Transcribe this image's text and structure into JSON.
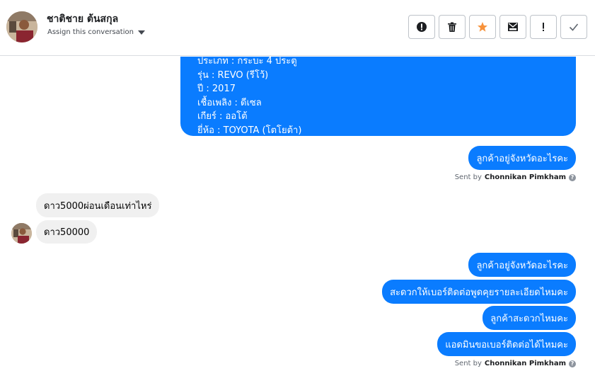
{
  "header": {
    "contact_name": "ชาติชาย ต้นสกุล",
    "assign_label": "Assign this conversation",
    "actions": [
      "spam-icon",
      "delete-icon",
      "star-icon",
      "mark-unread-icon",
      "important-icon",
      "done-icon"
    ]
  },
  "colors": {
    "accent": "#0a7cff",
    "star": "#f7923b",
    "incoming_bg": "#f0f0f0"
  },
  "details_lines": [
    "ประเภท : กระบะ 4 ประตู",
    "รุ่น : REVO (รีโว้)",
    "ปี : 2017",
    "เชื้อเพลิง : ดีเซล",
    "เกียร์ : ออโต้",
    "ยี่ห้อ : TOYOTA (โตโยต้า)"
  ],
  "messages": {
    "out1": "ลูกค้าอยู่จังหวัดอะไรคะ",
    "in1": "ดาว5000ผ่อนเดือนเท่าไหร่",
    "in2": "ดาว50000",
    "out2": "ลูกค้าอยู่จังหวัดอะไรคะ",
    "out3": "สะดวกให้เบอร์ติดต่อพูดคุยรายละเอียดไหมคะ",
    "out4": "ลูกค้าสะดวกไหมคะ",
    "out5": "แอดมินขอเบอร์ติดต่อได้ไหมคะ"
  },
  "sent_by": {
    "prefix": "Sent by",
    "name": "Chonnikan Pimkham",
    "help": "?"
  }
}
